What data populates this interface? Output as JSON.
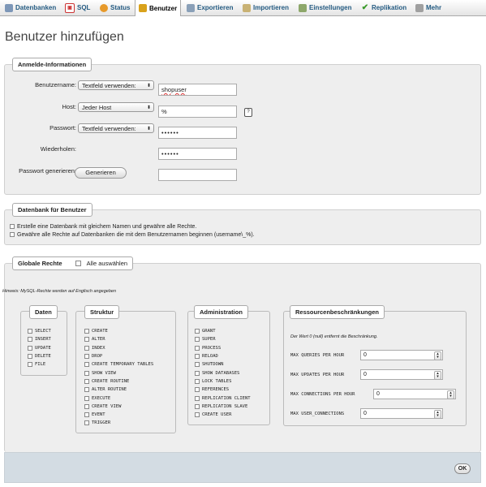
{
  "tabs": [
    {
      "label": "Datenbanken",
      "icon": "database-icon"
    },
    {
      "label": "SQL",
      "icon": "sql-icon"
    },
    {
      "label": "Status",
      "icon": "status-icon"
    },
    {
      "label": "Benutzer",
      "icon": "users-icon",
      "active": true
    },
    {
      "label": "Exportieren",
      "icon": "export-icon"
    },
    {
      "label": "Importieren",
      "icon": "import-icon"
    },
    {
      "label": "Einstellungen",
      "icon": "settings-icon"
    },
    {
      "label": "Replikation",
      "icon": "replication-icon"
    },
    {
      "label": "Mehr",
      "icon": "more-icon"
    }
  ],
  "page_title": "Benutzer hinzufügen",
  "login": {
    "legend": "Anmelde-Informationen",
    "username_label": "Benutzername:",
    "username_select": "Textfeld verwenden:",
    "username_value": "shopuser",
    "host_label": "Host:",
    "host_select": "Jeder Host",
    "host_value": "%",
    "password_label": "Passwort:",
    "password_select": "Textfeld verwenden:",
    "password_value": "••••••",
    "repeat_label": "Wiederholen:",
    "repeat_value": "••••••",
    "generate_label": "Passwort generieren:",
    "generate_button": "Generieren",
    "generate_value": ""
  },
  "database": {
    "legend": "Datenbank für Benutzer",
    "option1": "Erstelle eine Datenbank mit gleichem Namen und gewähre alle Rechte.",
    "option2": "Gewähre alle Rechte auf Datenbanken die mit dem Benutzernamen beginnen (username\\_%)."
  },
  "global": {
    "legend": "Globale Rechte",
    "select_all": "Alle auswählen",
    "hint": "Hinweis: MySQL-Rechte werden auf Englisch angegeben",
    "groups": {
      "daten": {
        "title": "Daten",
        "items": [
          "SELECT",
          "INSERT",
          "UPDATE",
          "DELETE",
          "FILE"
        ]
      },
      "struktur": {
        "title": "Struktur",
        "items": [
          "CREATE",
          "ALTER",
          "INDEX",
          "DROP",
          "CREATE TEMPORARY TABLES",
          "SHOW VIEW",
          "CREATE ROUTINE",
          "ALTER ROUTINE",
          "EXECUTE",
          "CREATE VIEW",
          "EVENT",
          "TRIGGER"
        ]
      },
      "administration": {
        "title": "Administration",
        "items": [
          "GRANT",
          "SUPER",
          "PROCESS",
          "RELOAD",
          "SHUTDOWN",
          "SHOW DATABASES",
          "LOCK TABLES",
          "REFERENCES",
          "REPLICATION CLIENT",
          "REPLICATION SLAVE",
          "CREATE USER"
        ]
      }
    },
    "resources": {
      "title": "Ressourcenbeschränkungen",
      "note": "Der Wert 0 (null) entfernt die Beschränkung.",
      "limits": [
        {
          "label": "MAX QUERIES PER HOUR",
          "value": "0"
        },
        {
          "label": "MAX UPDATES PER HOUR",
          "value": "0"
        },
        {
          "label": "MAX CONNECTIONS PER HOUR",
          "value": "0"
        },
        {
          "label": "MAX USER_CONNECTIONS",
          "value": "0"
        }
      ]
    }
  },
  "footer": {
    "ok": "OK"
  },
  "colors": {
    "tab_text": "#235a81",
    "fieldset_bg": "#eeeeee",
    "footer_bg": "#d3dce3"
  }
}
